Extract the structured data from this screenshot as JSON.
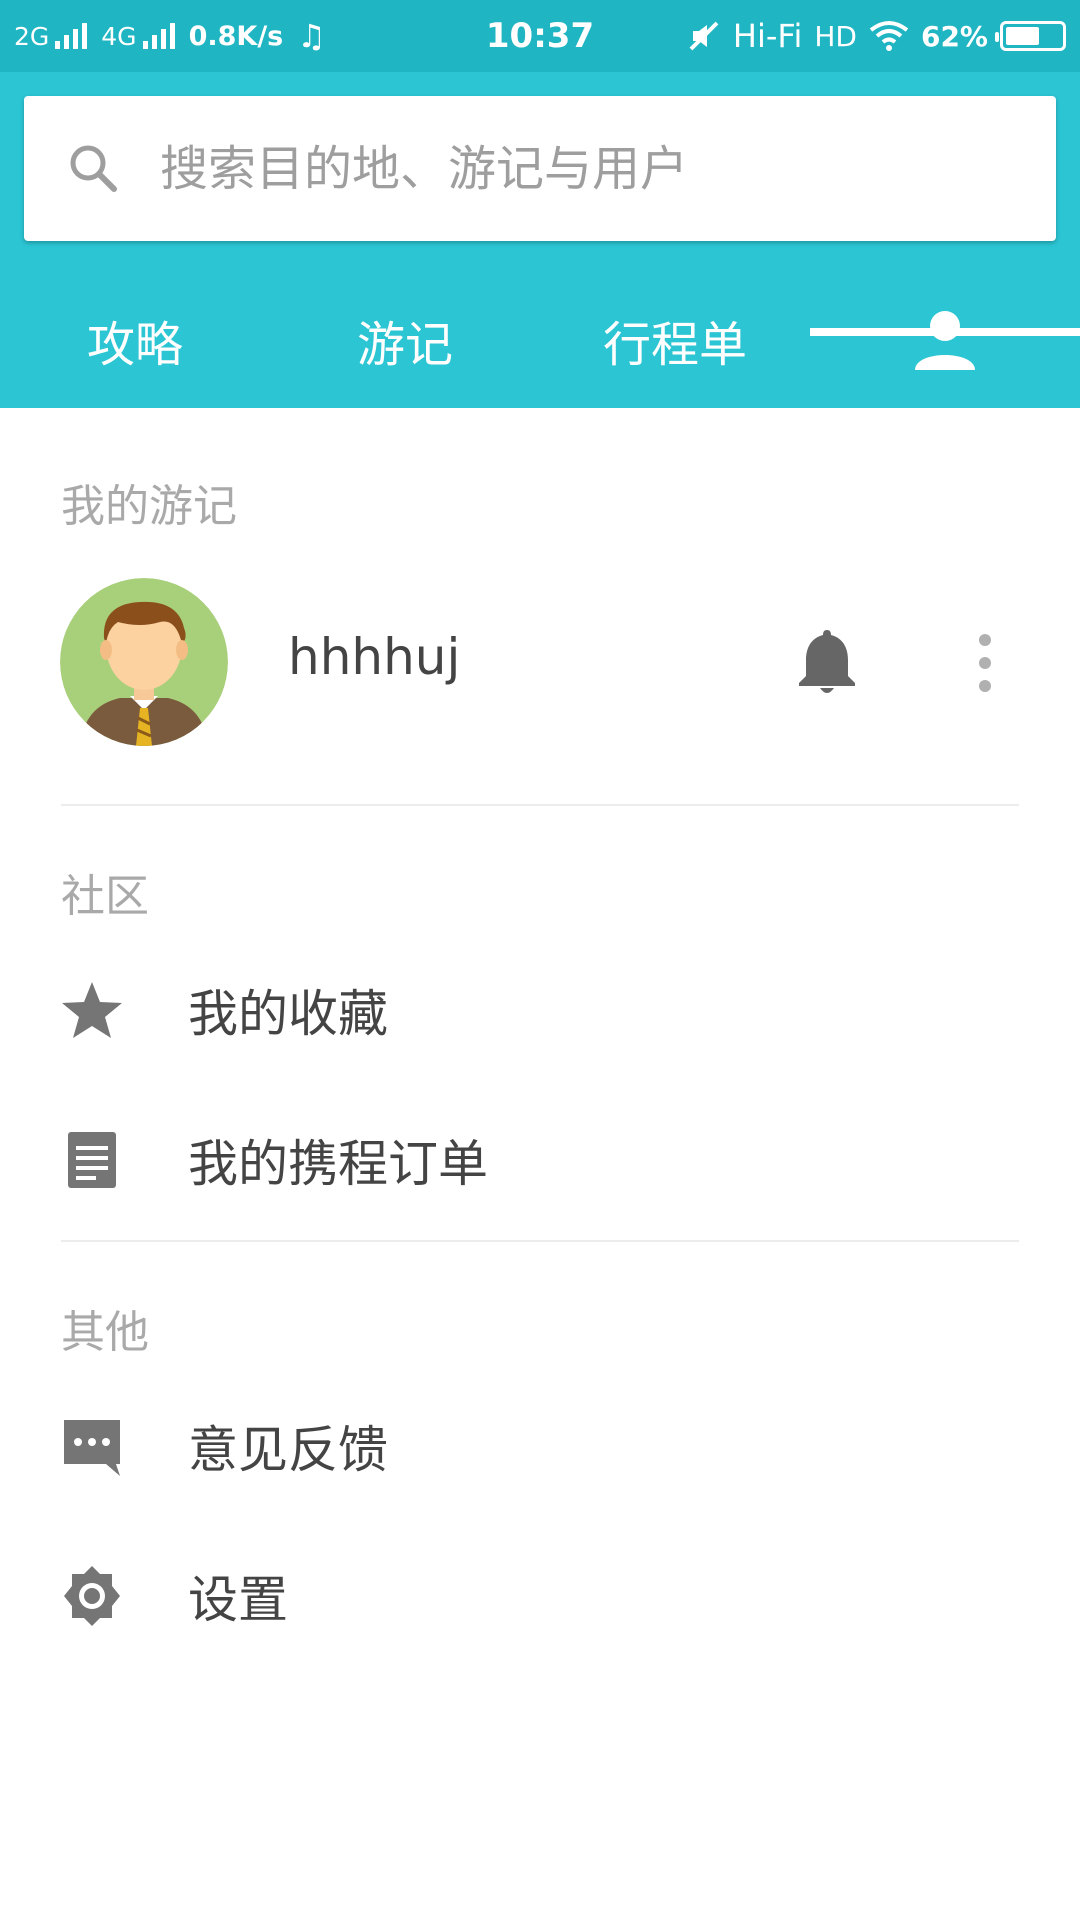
{
  "status_bar": {
    "net1": "2G",
    "net2": "4G",
    "speed": "0.8K/s",
    "time": "10:37",
    "hifi": "Hi-Fi",
    "hd": "HD",
    "battery": "62%",
    "battery_level": 0.62
  },
  "search": {
    "placeholder": "搜索目的地、游记与用户"
  },
  "tabs": [
    {
      "label": "攻略"
    },
    {
      "label": "游记"
    },
    {
      "label": "行程单"
    },
    {
      "icon": "person-icon",
      "selected": true
    }
  ],
  "sections": {
    "my_notes": "我的游记",
    "community": "社区",
    "other": "其他"
  },
  "profile": {
    "username": "hhhhuj"
  },
  "menu": {
    "favorites": "我的收藏",
    "orders": "我的携程订单",
    "feedback": "意见反馈",
    "settings": "设置"
  },
  "colors": {
    "accent": "#2bc5d3",
    "status_bar": "#1fb5c2",
    "icon_gray": "#757575"
  }
}
